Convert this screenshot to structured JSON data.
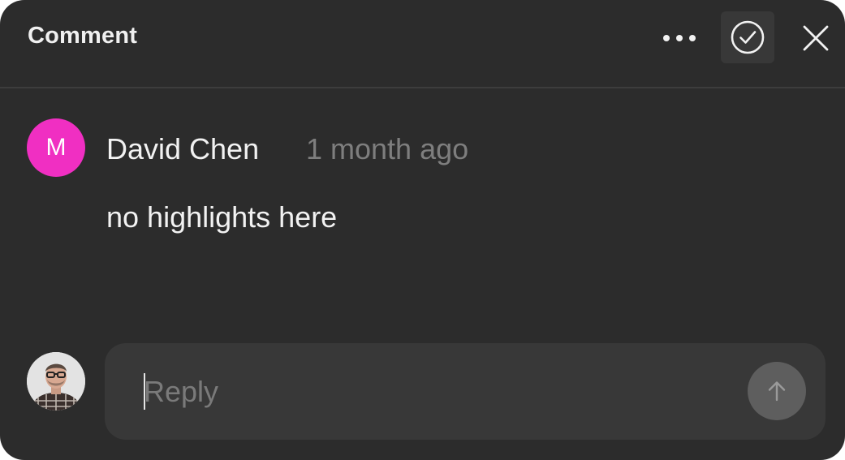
{
  "header": {
    "title": "Comment",
    "more_icon": "more-horizontal-icon",
    "resolve_icon": "check-circle-icon",
    "close_icon": "close-icon"
  },
  "comment": {
    "avatar_initial": "M",
    "avatar_color": "#f02fc2",
    "author": "David Chen",
    "timestamp": "1 month ago",
    "body": "no highlights here"
  },
  "reply": {
    "placeholder": "Reply",
    "value": "",
    "send_icon": "arrow-up-icon"
  },
  "colors": {
    "panel_bg": "#2c2c2c",
    "input_bg": "#383838",
    "send_button_disabled": "#5e5e5e"
  }
}
